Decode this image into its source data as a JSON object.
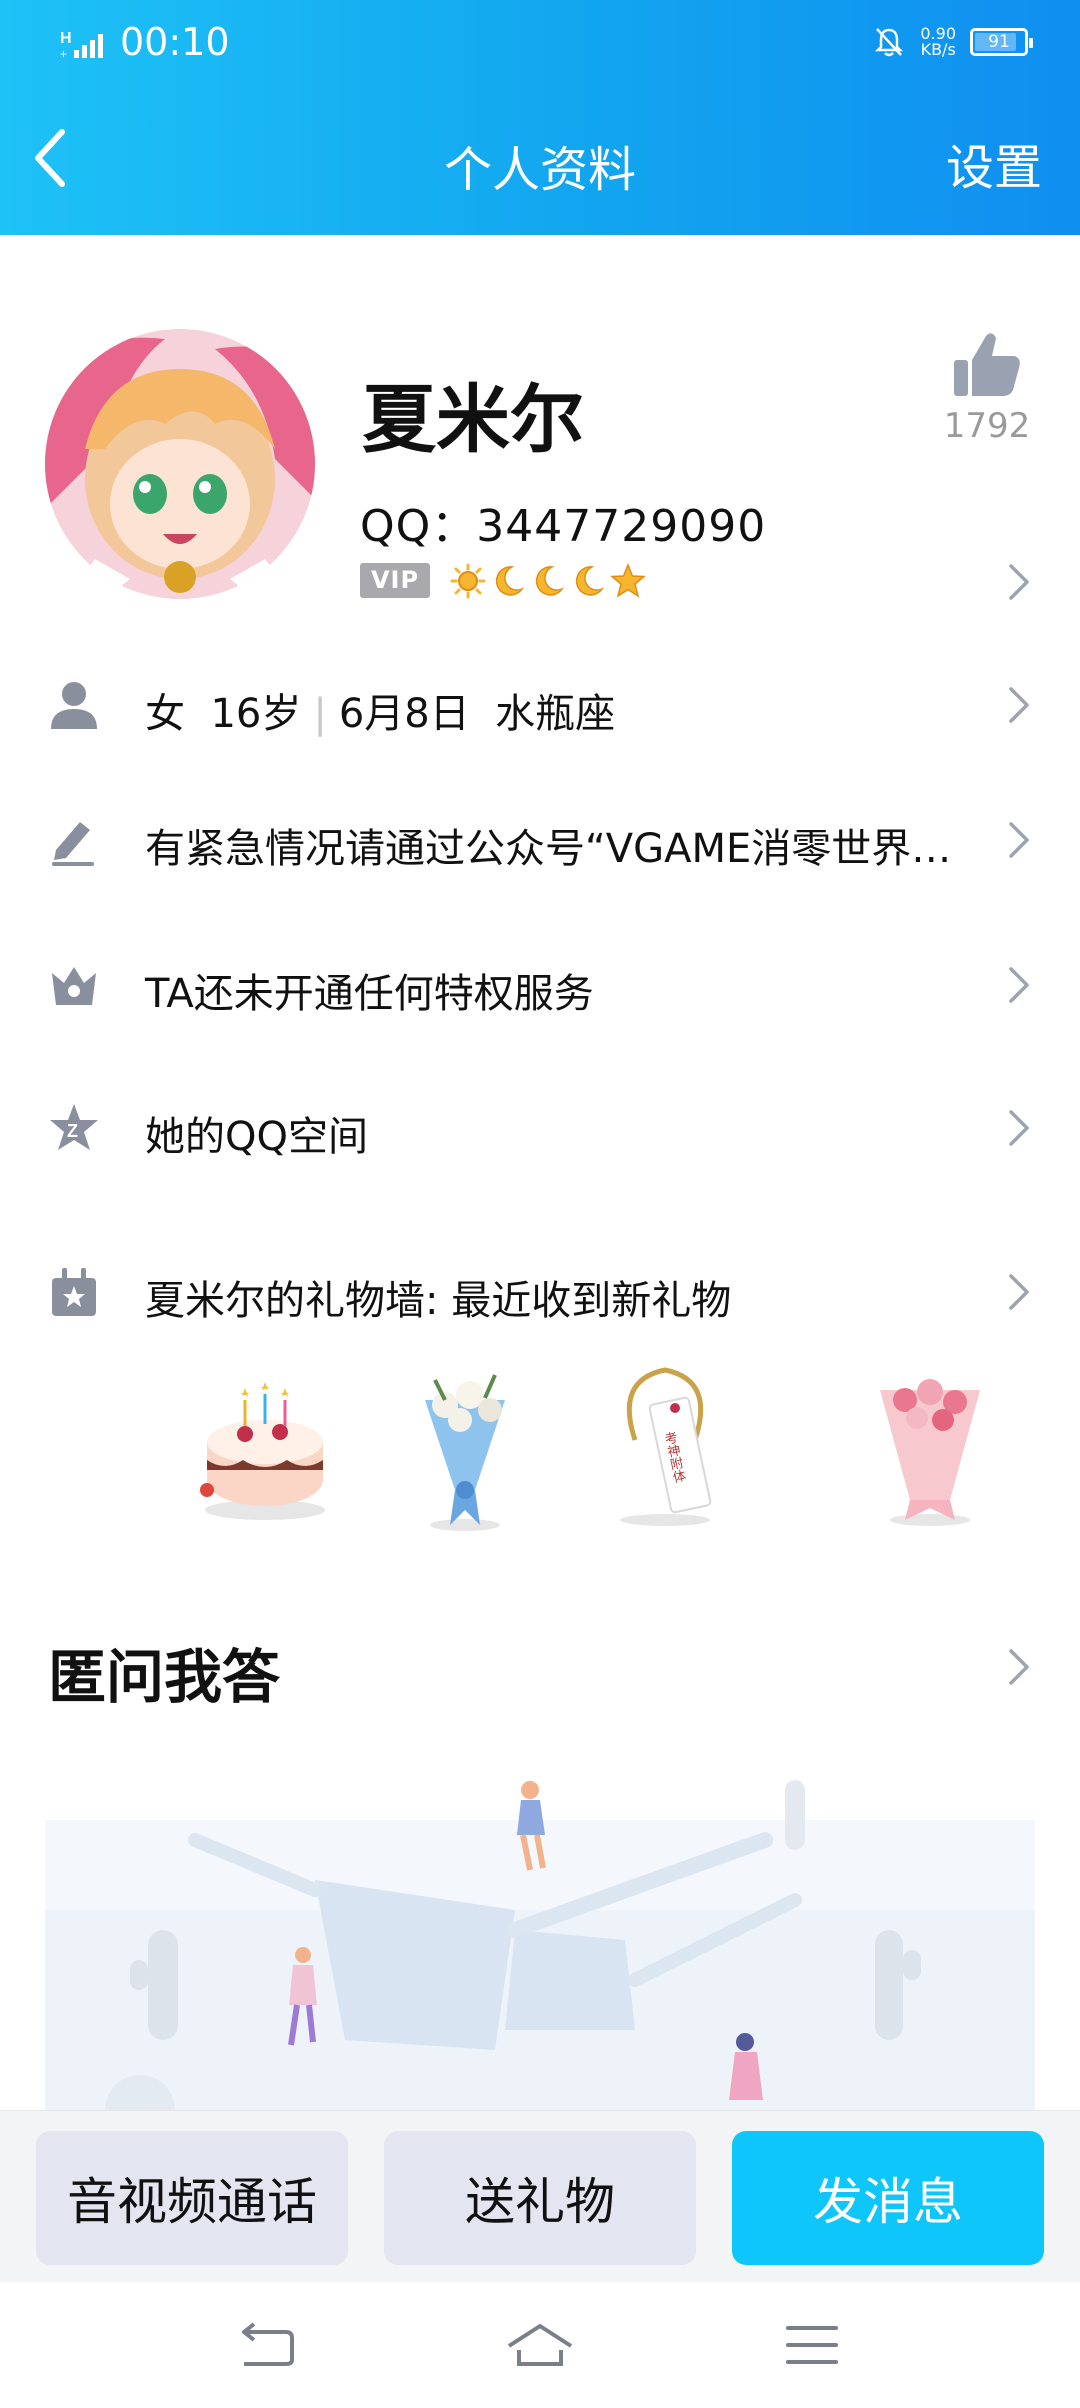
{
  "status_bar": {
    "time": "00:10",
    "speed_value": "0.90",
    "speed_unit": "KB/s",
    "battery": "91"
  },
  "nav": {
    "title": "个人资料",
    "settings": "设置"
  },
  "profile": {
    "name": "夏米尔",
    "qq": "QQ：3447729090",
    "like_count": "1792",
    "vip_badge": "VIP",
    "level_icons": [
      "sun-icon",
      "moon-icon",
      "moon-icon",
      "moon-icon",
      "star-icon"
    ]
  },
  "rows": {
    "info": {
      "gender": "女",
      "age": "16岁",
      "birthday": "6月8日",
      "zodiac": "水瓶座"
    },
    "signature": "有紧急情况请通过公众号“VGAME消零世界…",
    "privilege": "TA还未开通任何特权服务",
    "qzone": "她的QQ空间",
    "giftwall": "夏米尔的礼物墙: 最近收到新礼物"
  },
  "gifts": [
    "cake-gift",
    "blue-bouquet-gift",
    "charm-tag-gift",
    "pink-bouquet-gift"
  ],
  "gift_tag_text": "考神附体",
  "qa": {
    "title": "匿问我答"
  },
  "actions": {
    "call": "音视频通话",
    "gift": "送礼物",
    "message": "发消息"
  },
  "colors": {
    "header_start": "#1ec2f7",
    "header_end": "#0f8ff0",
    "accent": "#0fc6fb",
    "icon_grey": "#8a8f9e"
  }
}
